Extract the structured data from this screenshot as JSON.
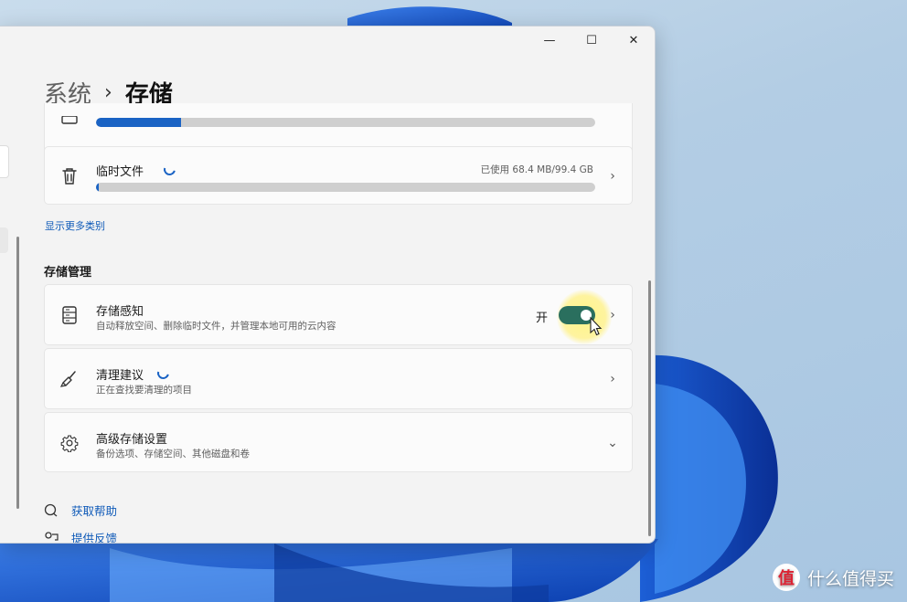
{
  "window": {
    "minimize_glyph": "—",
    "maximize_glyph": "☐",
    "close_glyph": "✕"
  },
  "breadcrumb": {
    "parent": "系统",
    "separator": "›",
    "current": "存储"
  },
  "categories": {
    "top_partial_progress": 0.17,
    "temp_files": {
      "label": "临时文件",
      "usage": "已使用 68.4 MB/99.4 GB",
      "progress": 0.005
    },
    "show_more_link": "显示更多类别"
  },
  "storage_management": {
    "section_title": "存储管理",
    "storage_sense": {
      "title": "存储感知",
      "subtitle": "自动释放空间、删除临时文件，并管理本地可用的云内容",
      "toggle_label": "开",
      "toggle_on": true
    },
    "cleanup": {
      "title": "清理建议",
      "subtitle": "正在查找要清理的项目"
    },
    "advanced": {
      "title": "高级存储设置",
      "subtitle": "备份选项、存储空间、其他磁盘和卷"
    }
  },
  "footer_links": {
    "help": "获取帮助",
    "feedback": "提供反馈"
  },
  "watermark": {
    "logo_glyph": "值",
    "text": "什么值得买"
  },
  "colors": {
    "accent": "#1a63c4",
    "toggle_on": "#2a6f5e",
    "link": "#0f5ab8"
  }
}
